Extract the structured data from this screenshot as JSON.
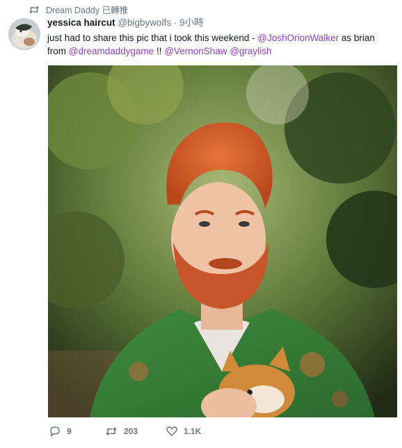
{
  "retweet_header": {
    "icon": "retweet-icon",
    "text": "Dream Daddy 已轉推"
  },
  "tweet": {
    "author": {
      "name": "yessica haircut",
      "handle": "@bigbywolfs",
      "separator": "·",
      "time": "9小時"
    },
    "text": {
      "part1": "just had to share this pic that i took this weekend - ",
      "mention1": "@JoshOrionWalker",
      "part2": " as brian from ",
      "mention2": "@dreamdaddygame",
      "part3": " !! ",
      "mention3": "@VernonShaw",
      "part4": " ",
      "mention4": "@graylish"
    },
    "colors": {
      "mention": "#8a42b8",
      "muted": "#657786"
    }
  },
  "actions": {
    "reply": {
      "icon": "reply-icon",
      "count": "9"
    },
    "retweet": {
      "icon": "retweet-icon",
      "count": "203"
    },
    "like": {
      "icon": "heart-icon",
      "count": "1.1K"
    }
  }
}
